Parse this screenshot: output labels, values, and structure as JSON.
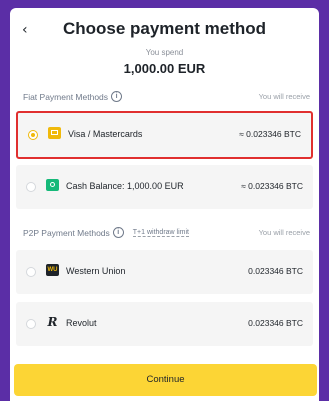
{
  "header": {
    "back_glyph": "‹",
    "title": "Choose payment method",
    "spend_label": "You spend",
    "amount": "1,000.00 EUR"
  },
  "fiat": {
    "section_label": "Fiat Payment Methods",
    "receive_label": "You will receive",
    "methods": [
      {
        "label": "Visa / Mastercards",
        "value": "≈ 0.023346 BTC",
        "icon": "credit-card-icon",
        "selected": true
      },
      {
        "label": "Cash Balance: 1,000.00 EUR",
        "value": "≈ 0.023346 BTC",
        "icon": "cash-icon",
        "selected": false
      }
    ]
  },
  "p2p": {
    "section_label": "P2P Payment Methods",
    "limit_label": "T+1  withdraw limit",
    "receive_label": "You will receive",
    "methods": [
      {
        "label": "Western Union",
        "value": "0.023346 BTC",
        "icon": "western-union-icon",
        "icon_text": "WU",
        "selected": false
      },
      {
        "label": "Revolut",
        "value": "0.023346 BTC",
        "icon": "revolut-icon",
        "icon_text": "R",
        "selected": false
      }
    ]
  },
  "footer": {
    "continue_label": "Continue"
  },
  "colors": {
    "accent": "#fcd535",
    "highlight": "#e02f2f",
    "border": "#5b2ea6"
  }
}
